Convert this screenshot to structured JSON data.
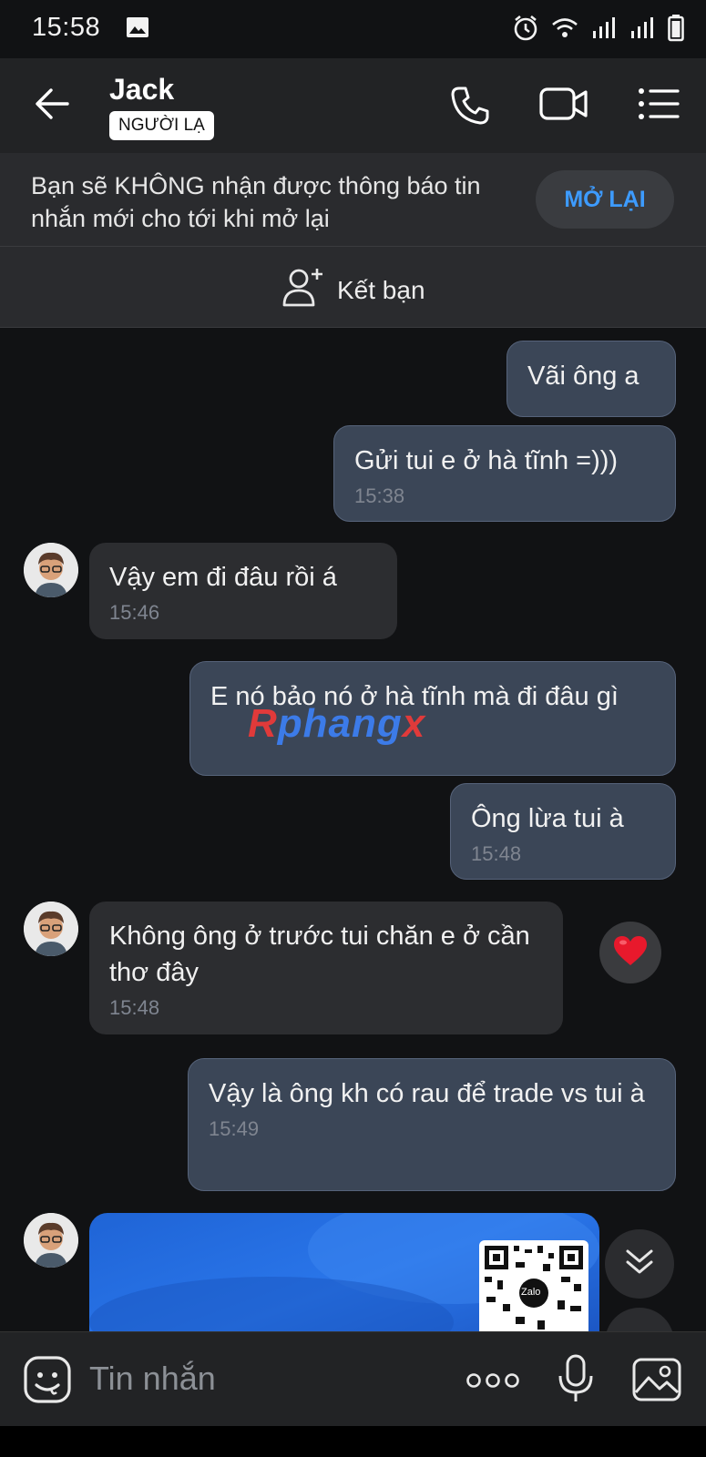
{
  "status_bar": {
    "time": "15:58",
    "icons": [
      "image-icon",
      "alarm-icon",
      "wifi-icon",
      "signal-icon",
      "signal-icon",
      "battery-icon"
    ]
  },
  "header": {
    "contact_name": "Jack",
    "badge": "NGƯỜI LẠ",
    "icons": [
      "back-arrow-icon",
      "phone-icon",
      "video-call-icon",
      "menu-list-icon"
    ]
  },
  "notice": {
    "text": "Bạn sẽ KHÔNG nhận được thông báo tin nhắn mới cho tới khi mở lại",
    "button": "MỞ LẠI"
  },
  "add_friend": {
    "label": "Kết bạn",
    "icon": "add-friend-icon"
  },
  "messages": [
    {
      "side": "out",
      "text": "Vãi ông a",
      "time": ""
    },
    {
      "side": "out",
      "text": "Gửi tui e ở hà tĩnh =)))",
      "time": "15:38"
    },
    {
      "side": "in",
      "text": "Vậy em đi đâu rồi á",
      "time": "15:46"
    },
    {
      "side": "out",
      "text": "E nó bảo nó ở hà tĩnh mà đi đâu gì",
      "time": ""
    },
    {
      "side": "out",
      "text": "Ông lừa tui à",
      "time": "15:48"
    },
    {
      "side": "in",
      "text": "Không ông ở trước tui chăn e ở cần thơ đây",
      "time": "15:48",
      "reaction": "heart-icon"
    },
    {
      "side": "out",
      "text": "Vậy là ông kh có rau để trade vs tui à",
      "time": "15:49"
    },
    {
      "side": "in",
      "type": "image",
      "caption": "Zalo"
    }
  ],
  "watermark": {
    "part1": "R",
    "part2": "phang",
    "part3": "x"
  },
  "composer": {
    "placeholder": "Tin nhắn",
    "icons": [
      "emoji-icon",
      "more-icon",
      "microphone-icon",
      "gallery-icon"
    ]
  },
  "colors": {
    "background": "#111214",
    "outgoing_bubble": "#3b4657",
    "incoming_bubble": "#2c2d30",
    "accent": "#3d9bff"
  }
}
